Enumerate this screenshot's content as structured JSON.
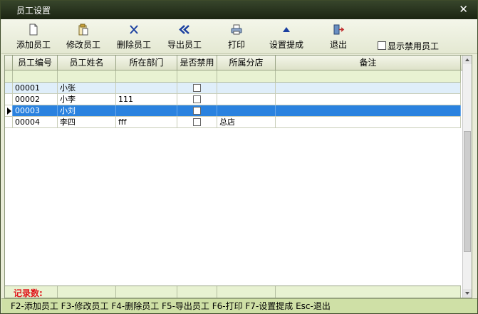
{
  "window": {
    "title": "员工设置"
  },
  "toolbar": {
    "items": [
      {
        "label": "添加员工",
        "icon": "new-page-icon"
      },
      {
        "label": "修改员工",
        "icon": "clipboard-edit-icon"
      },
      {
        "label": "删除员工",
        "icon": "x-delete-icon"
      },
      {
        "label": "导出员工",
        "icon": "double-chevron-left-icon"
      },
      {
        "label": "打印",
        "icon": "printer-icon"
      },
      {
        "label": "设置提成",
        "icon": "triangle-up-icon"
      },
      {
        "label": "退出",
        "icon": "exit-door-icon"
      }
    ],
    "show_disabled_label": "显示禁用员工",
    "show_disabled_checked": false
  },
  "grid": {
    "columns": [
      "员工编号",
      "员工姓名",
      "所在部门",
      "是否禁用",
      "所属分店",
      "备注"
    ],
    "rows": [
      {
        "id": "00001",
        "name": "小张",
        "dept": "",
        "disabled": false,
        "branch": "",
        "note": ""
      },
      {
        "id": "00002",
        "name": "小李",
        "dept": "111",
        "disabled": false,
        "branch": "",
        "note": ""
      },
      {
        "id": "00003",
        "name": "小刘",
        "dept": "",
        "disabled": false,
        "branch": "",
        "note": ""
      },
      {
        "id": "00004",
        "name": "李四",
        "dept": "fff",
        "disabled": false,
        "branch": "总店",
        "note": ""
      }
    ],
    "selected_row": 2,
    "record_count_label": "记录数:"
  },
  "status": {
    "text": "F2-添加员工 F3-修改员工 F4-删除员工 F5-导出员工 F6-打印 F7-设置提成 Esc-退出"
  }
}
